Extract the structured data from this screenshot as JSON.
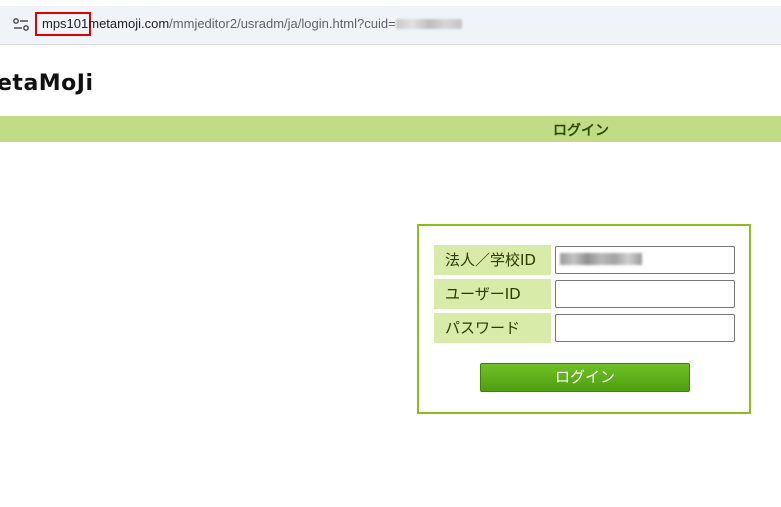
{
  "browser": {
    "url_highlighted": "mps101",
    "url_host": "metamoji.com",
    "url_path": "/mmjeditor2/usradm/ja/login.html?cuid="
  },
  "logo_text": "etaMoJi",
  "header": {
    "title": "ログイン"
  },
  "form": {
    "corp_label": "法人／学校ID",
    "user_label": "ユーザーID",
    "password_label": "パスワード",
    "user_value": "",
    "password_value": "",
    "login_button": "ログイン"
  },
  "colors": {
    "header_band": "#c0dc84",
    "label_bg": "#d9eba8",
    "box_border": "#8cbd1c",
    "button": "#56a616",
    "url_highlight": "#e00000"
  },
  "icons": [
    "tune-icon"
  ]
}
